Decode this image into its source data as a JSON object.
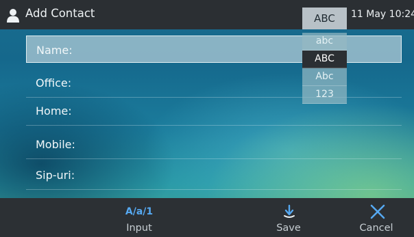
{
  "topbar": {
    "icon": "user-icon",
    "title": "Add Contact",
    "input_mode": "ABC",
    "datetime": "11 May 10:24"
  },
  "form": {
    "fields": [
      {
        "label": "Name:"
      },
      {
        "label": "Office:"
      },
      {
        "label": "Home:"
      },
      {
        "label": "Mobile:"
      },
      {
        "label": "Sip-uri:"
      }
    ],
    "selected_index": 0
  },
  "input_menu": {
    "options": [
      "abc",
      "ABC",
      "Abc",
      "123"
    ],
    "selected": "ABC"
  },
  "softkeys": {
    "input": {
      "icon_text": "A/a/1",
      "label": "Input"
    },
    "save": {
      "icon": "save-icon",
      "label": "Save"
    },
    "cancel": {
      "icon": "close-icon",
      "label": "Cancel"
    }
  },
  "colors": {
    "bar_background": "#2b2f33",
    "accent_blue": "#56a9f2"
  }
}
